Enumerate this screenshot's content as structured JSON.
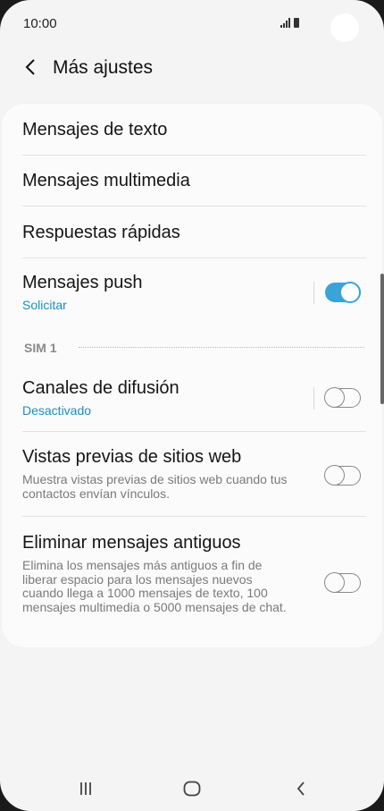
{
  "status": {
    "time": "10:00"
  },
  "header": {
    "title": "Más ajustes"
  },
  "settings": {
    "text_messages": "Mensajes de texto",
    "multimedia_messages": "Mensajes multimedia",
    "quick_responses": "Respuestas rápidas",
    "push_messages": {
      "title": "Mensajes push",
      "subtitle": "Solicitar",
      "enabled": true
    },
    "section_label": "SIM 1",
    "broadcast_channels": {
      "title": "Canales de difusión",
      "subtitle": "Desactivado",
      "enabled": false
    },
    "web_previews": {
      "title": "Vistas previas de sitios web",
      "description": "Muestra vistas previas de sitios web cuando tus contactos envían vínculos.",
      "enabled": false
    },
    "delete_old_messages": {
      "title": "Eliminar mensajes antiguos",
      "description": "Elimina los mensajes más antiguos a fin de liberar espacio para los mensajes nuevos cuando llega a 1000 mensajes de texto, 100 mensajes multimedia o 5000 mensajes de chat.",
      "enabled": false
    }
  },
  "colors": {
    "accent": "#3aa3d8",
    "subtitle": "#1a8fc3"
  }
}
